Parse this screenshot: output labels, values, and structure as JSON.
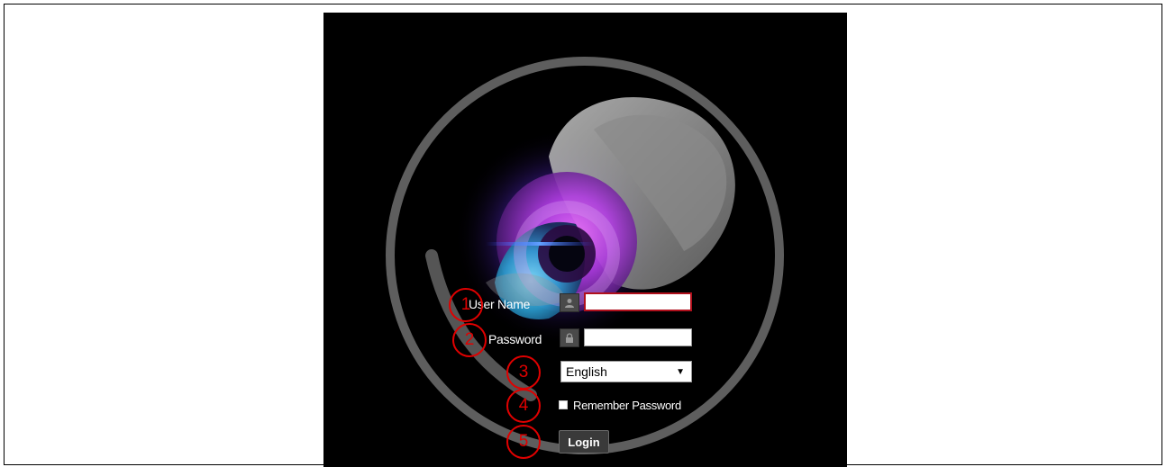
{
  "form": {
    "username_label": "User Name",
    "username_value": "",
    "password_label": "Password",
    "password_value": "",
    "language_selected": "English",
    "remember_label": "Remember Password",
    "remember_checked": false,
    "login_label": "Login"
  },
  "annotations": [
    "1",
    "2",
    "3",
    "4",
    "5"
  ],
  "icons": {
    "user": "user-icon",
    "lock": "lock-icon",
    "dropdown": "chevron-down-icon",
    "dropdown_glyph": "▼"
  },
  "colors": {
    "background": "#000000",
    "annotation": "#e00000",
    "focus_border": "#b0101c"
  }
}
